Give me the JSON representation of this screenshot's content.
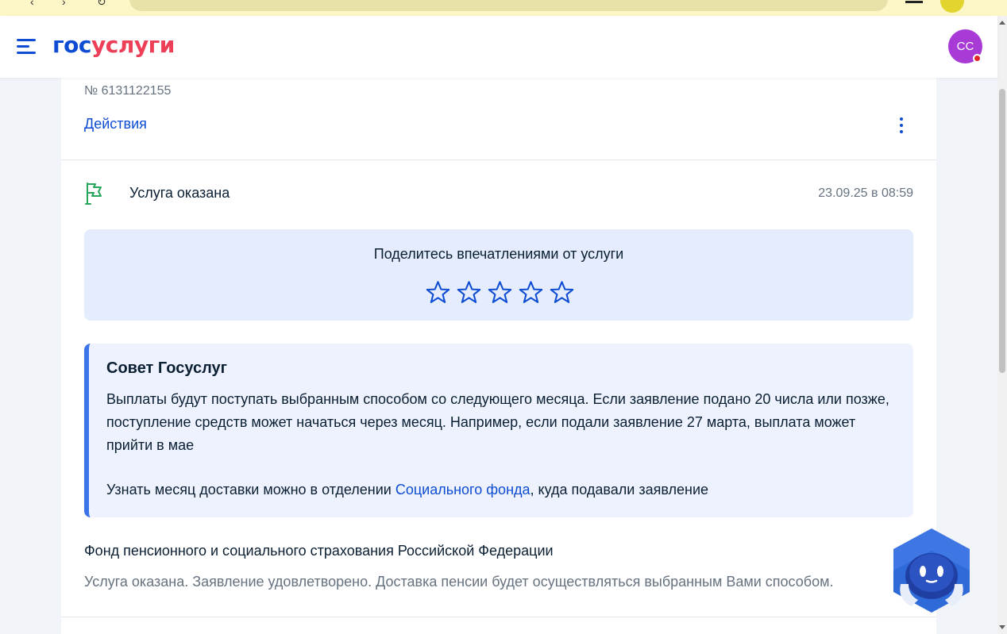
{
  "browser": {
    "colors": {
      "bar_bg": "#fdf7c7",
      "omnibox_bg": "#e8e2a8"
    }
  },
  "header": {
    "logo_part1": "гос",
    "logo_part2": "услуги",
    "avatar_initials": "СС",
    "colors": {
      "brand_blue": "#0d4cd3",
      "brand_red": "#ee3f58",
      "avatar_bg": "#a83ad6",
      "notification_dot": "#e3242b"
    }
  },
  "application": {
    "number": "№ 6131122155",
    "actions_label": "Действия"
  },
  "status": {
    "title": "Услуга оказана",
    "date": "23.09.25 в 08:59",
    "icon": "flag-icon",
    "icon_color": "#25a65a"
  },
  "rating": {
    "prompt": "Поделитесь впечатлениями от услуги",
    "stars_total": 5,
    "stars_selected": 0,
    "star_color": "#0d4cd3"
  },
  "tip": {
    "title": "Совет Госуслуг",
    "text": "Выплаты будут поступать выбранным способом со следующего месяца. Если заявление подано 20 числа или позже, поступление средств может начаться через месяц. Например, если подали заявление 27 марта, выплата может прийти в мае",
    "text2_before": "Узнать месяц доставки можно в отделении ",
    "text2_link": "Социального фонда",
    "text2_after": ", куда подавали заявление",
    "accent_color": "#3a74e8"
  },
  "organization": {
    "name": "Фонд пенсионного и социального страхования Российской Федерации",
    "message": "Услуга оказана. Заявление удовлетворено. Доставка пенсии будет осуществляться выбранным Вами способом."
  },
  "assistant": {
    "icon": "robot-assistant-icon"
  }
}
